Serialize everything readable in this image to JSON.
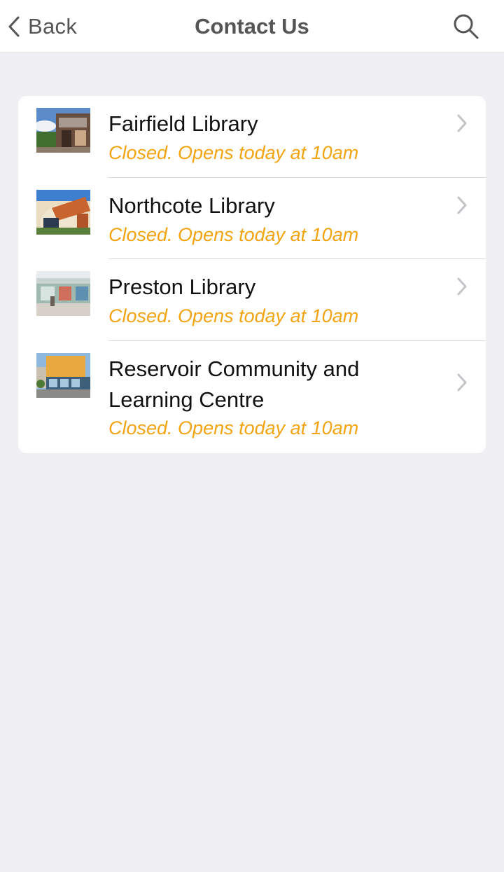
{
  "nav": {
    "back_label": "Back",
    "title": "Contact Us",
    "back_icon": "chevron-left-icon",
    "search_icon": "search-icon"
  },
  "libraries": [
    {
      "name": "Fairfield Library",
      "status": "Closed. Opens today at 10am"
    },
    {
      "name": "Northcote Library",
      "status": "Closed. Opens today at 10am"
    },
    {
      "name": "Preston Library",
      "status": "Closed. Opens today at 10am"
    },
    {
      "name": "Reservoir Community and Learning Centre",
      "status": "Closed. Opens today at 10am"
    }
  ],
  "colors": {
    "status": "#f2a413",
    "background": "#efeff4",
    "nav_text": "#555555"
  }
}
